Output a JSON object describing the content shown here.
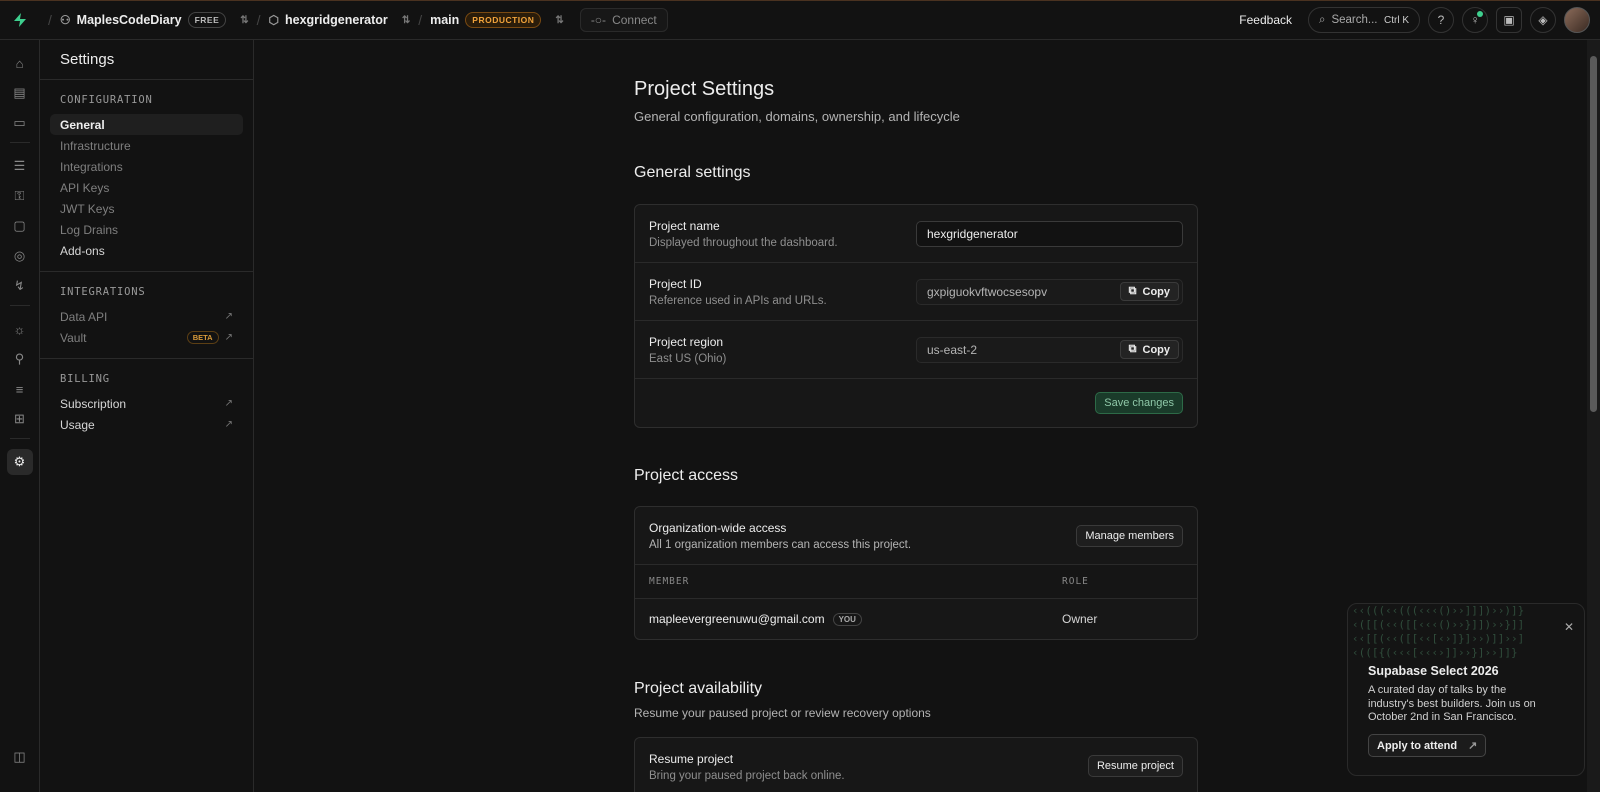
{
  "topbar": {
    "org_name": "MaplesCodeDiary",
    "org_plan": "FREE",
    "project_name": "hexgridgenerator",
    "branch_name": "main",
    "branch_badge": "PRODUCTION",
    "connect_label": "Connect",
    "feedback_label": "Feedback",
    "search_placeholder": "Search...",
    "search_shortcut": "Ctrl K"
  },
  "sidebar": {
    "title": "Settings",
    "configuration": {
      "heading": "CONFIGURATION",
      "items": [
        "General",
        "Infrastructure",
        "Integrations",
        "API Keys",
        "JWT Keys",
        "Log Drains",
        "Add-ons"
      ]
    },
    "integrations": {
      "heading": "INTEGRATIONS",
      "items": [
        "Data API",
        "Vault"
      ],
      "vault_badge": "BETA"
    },
    "billing": {
      "heading": "BILLING",
      "items": [
        "Subscription",
        "Usage"
      ]
    }
  },
  "page": {
    "title": "Project Settings",
    "subtitle": "General configuration, domains, ownership, and lifecycle"
  },
  "general": {
    "heading": "General settings",
    "name_label": "Project name",
    "name_desc": "Displayed throughout the dashboard.",
    "name_value": "hexgridgenerator",
    "id_label": "Project ID",
    "id_desc": "Reference used in APIs and URLs.",
    "id_value": "gxpiguokvftwocsesopv",
    "region_label": "Project region",
    "region_desc": "East US (Ohio)",
    "region_value": "us-east-2",
    "copy_label": "Copy",
    "save_label": "Save changes"
  },
  "access": {
    "heading": "Project access",
    "org_label": "Organization-wide access",
    "org_desc": "All 1 organization members can access this project.",
    "manage_label": "Manage members",
    "col_member": "MEMBER",
    "col_role": "ROLE",
    "member_email": "mapleevergreenuwu@gmail.com",
    "member_badge": "YOU",
    "member_role": "Owner"
  },
  "availability": {
    "heading": "Project availability",
    "subtitle": "Resume your paused project or review recovery options",
    "resume_label": "Resume project",
    "resume_desc": "Bring your paused project back online.",
    "resume_button": "Resume project"
  },
  "promo": {
    "title": "Supabase Select 2026",
    "text": "A curated day of talks by the industry's best builders. Join us on October 2nd in San Francisco.",
    "button": "Apply to attend"
  },
  "colors": {
    "accent": "#3ecf8e",
    "production": "#f1a33b",
    "background": "#121212"
  }
}
